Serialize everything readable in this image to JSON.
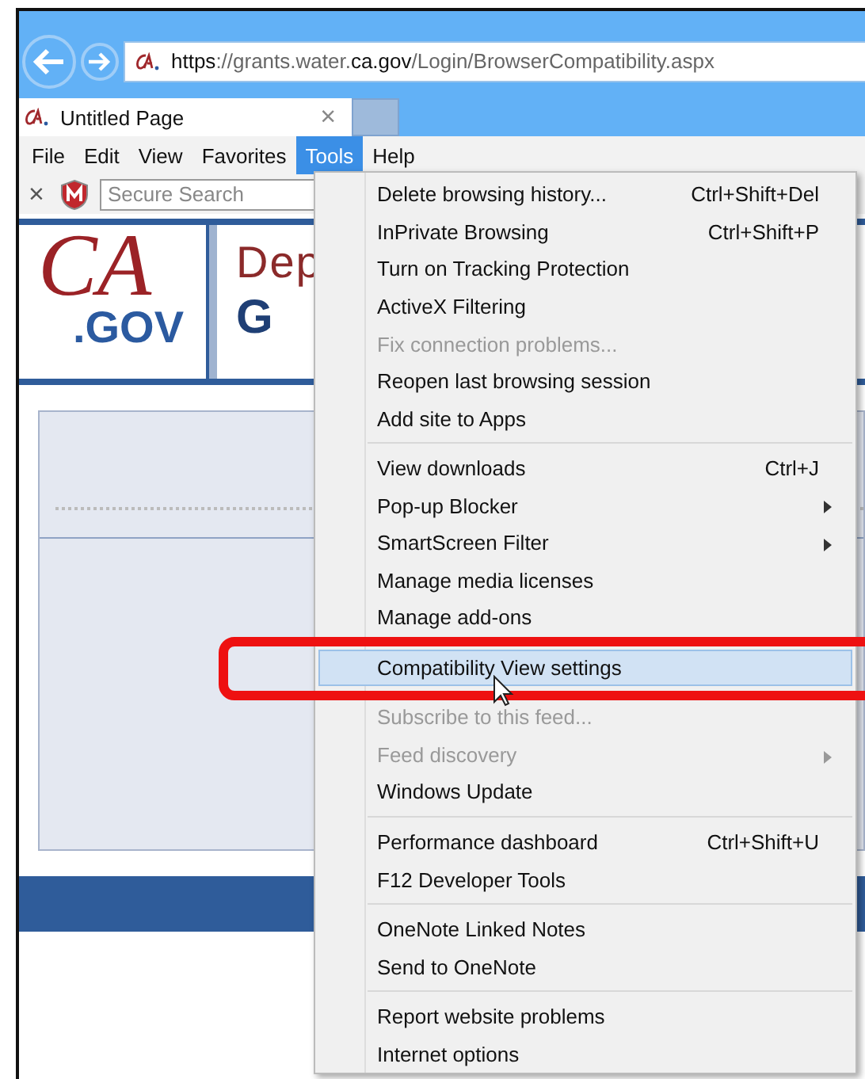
{
  "address_bar": {
    "parts": [
      {
        "text": "https",
        "strong": true
      },
      {
        "text": "://grants.water.",
        "strong": false
      },
      {
        "text": "ca.gov",
        "strong": true
      },
      {
        "text": "/Login/BrowserCompatibility.aspx",
        "strong": false
      }
    ]
  },
  "tabs": [
    {
      "label": "Untitled Page",
      "close": "×",
      "selected": true
    }
  ],
  "menu_bar": [
    {
      "label": "File",
      "selected": false
    },
    {
      "label": "Edit",
      "selected": false
    },
    {
      "label": "View",
      "selected": false
    },
    {
      "label": "Favorites",
      "selected": false
    },
    {
      "label": "Tools",
      "selected": true
    },
    {
      "label": "Help",
      "selected": false
    }
  ],
  "toolbar": {
    "close": "×",
    "search": {
      "placeholder": "Secure Search"
    }
  },
  "page": {
    "logo": {
      "mark": "CA",
      "suffix": ".GOV"
    },
    "heading_top": "Dep",
    "heading_bottom": "G"
  },
  "tools_menu": [
    [
      {
        "label": "Delete browsing history...",
        "shortcut": "Ctrl+Shift+Del",
        "disabled": false,
        "submenu": false,
        "selected": false
      },
      {
        "label": "InPrivate Browsing",
        "shortcut": "Ctrl+Shift+P",
        "disabled": false,
        "submenu": false,
        "selected": false
      },
      {
        "label": "Turn on Tracking Protection",
        "disabled": false,
        "submenu": false,
        "selected": false
      },
      {
        "label": "ActiveX Filtering",
        "disabled": false,
        "submenu": false,
        "selected": false
      },
      {
        "label": "Fix connection problems...",
        "disabled": true,
        "submenu": false,
        "selected": false
      },
      {
        "label": "Reopen last browsing session",
        "disabled": false,
        "submenu": false,
        "selected": false
      },
      {
        "label": "Add site to Apps",
        "disabled": false,
        "submenu": false,
        "selected": false
      }
    ],
    [
      {
        "label": "View downloads",
        "shortcut": "Ctrl+J",
        "disabled": false,
        "submenu": false,
        "selected": false
      },
      {
        "label": "Pop-up Blocker",
        "disabled": false,
        "submenu": true,
        "selected": false
      },
      {
        "label": "SmartScreen Filter",
        "disabled": false,
        "submenu": true,
        "selected": false
      },
      {
        "label": "Manage media licenses",
        "disabled": false,
        "submenu": false,
        "selected": false
      },
      {
        "label": "Manage add-ons",
        "disabled": false,
        "submenu": false,
        "selected": false
      }
    ],
    [
      {
        "label": "Compatibility View settings",
        "disabled": false,
        "submenu": false,
        "selected": true
      }
    ],
    [
      {
        "label": "Subscribe to this feed...",
        "disabled": true,
        "submenu": false,
        "selected": false
      },
      {
        "label": "Feed discovery",
        "disabled": true,
        "submenu": true,
        "selected": false
      },
      {
        "label": "Windows Update",
        "disabled": false,
        "submenu": false,
        "selected": false
      }
    ],
    [
      {
        "label": "Performance dashboard",
        "shortcut": "Ctrl+Shift+U",
        "disabled": false,
        "submenu": false,
        "selected": false
      },
      {
        "label": "F12 Developer Tools",
        "disabled": false,
        "submenu": false,
        "selected": false
      }
    ],
    [
      {
        "label": "OneNote Linked Notes",
        "disabled": false,
        "submenu": false,
        "selected": false
      },
      {
        "label": "Send to OneNote",
        "disabled": false,
        "submenu": false,
        "selected": false
      }
    ],
    [
      {
        "label": "Report website problems",
        "disabled": false,
        "submenu": false,
        "selected": false
      },
      {
        "label": "Internet options",
        "disabled": false,
        "submenu": false,
        "selected": false
      }
    ]
  ]
}
